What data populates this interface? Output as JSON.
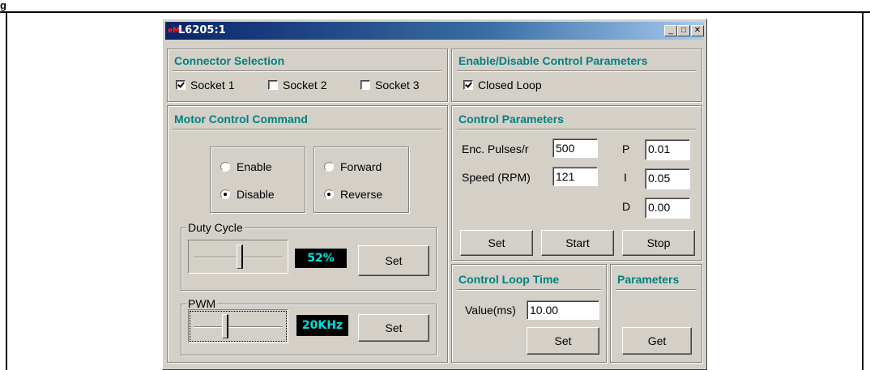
{
  "window": {
    "title": "L6205:1",
    "logo_text": "eMI",
    "minimize_icon": "minimize-icon",
    "maximize_icon": "maximize-icon",
    "close_icon": "close-icon"
  },
  "connector_selection": {
    "title": "Connector Selection",
    "sockets": [
      {
        "label": "Socket 1",
        "checked": true
      },
      {
        "label": "Socket 2",
        "checked": false
      },
      {
        "label": "Socket 3",
        "checked": false
      }
    ]
  },
  "enable_disable": {
    "title": "Enable/Disable Control Parameters",
    "closed_loop_label": "Closed Loop",
    "closed_loop_checked": true
  },
  "motor_control": {
    "title": "Motor Control Command",
    "enable_label": "Enable",
    "disable_label": "Disable",
    "forward_label": "Forward",
    "reverse_label": "Reverse",
    "state": "Disable",
    "direction": "Reverse",
    "duty_cycle": {
      "label": "Duty Cycle",
      "display": "52%",
      "level": 0.52,
      "set_label": "Set"
    },
    "pwm": {
      "label": "PWM",
      "display": "20KHz",
      "level": 0.35,
      "set_label": "Set"
    }
  },
  "control_parameters": {
    "title": "Control Parameters",
    "enc_pulses_label": "Enc. Pulses/r",
    "enc_pulses_value": "500",
    "speed_label": "Speed (RPM)",
    "speed_value": "121",
    "p_label": "P",
    "p_value": "0.01",
    "i_label": "I",
    "i_value": "0.05",
    "d_label": "D",
    "d_value": "0.00",
    "set_label": "Set",
    "start_label": "Start",
    "stop_label": "Stop"
  },
  "control_loop_time": {
    "title": "Control Loop Time",
    "value_label": "Value(ms)",
    "value": "10.00",
    "set_label": "Set"
  },
  "parameters": {
    "title": "Parameters",
    "get_label": "Get"
  },
  "page": {
    "corner_label": "g"
  }
}
